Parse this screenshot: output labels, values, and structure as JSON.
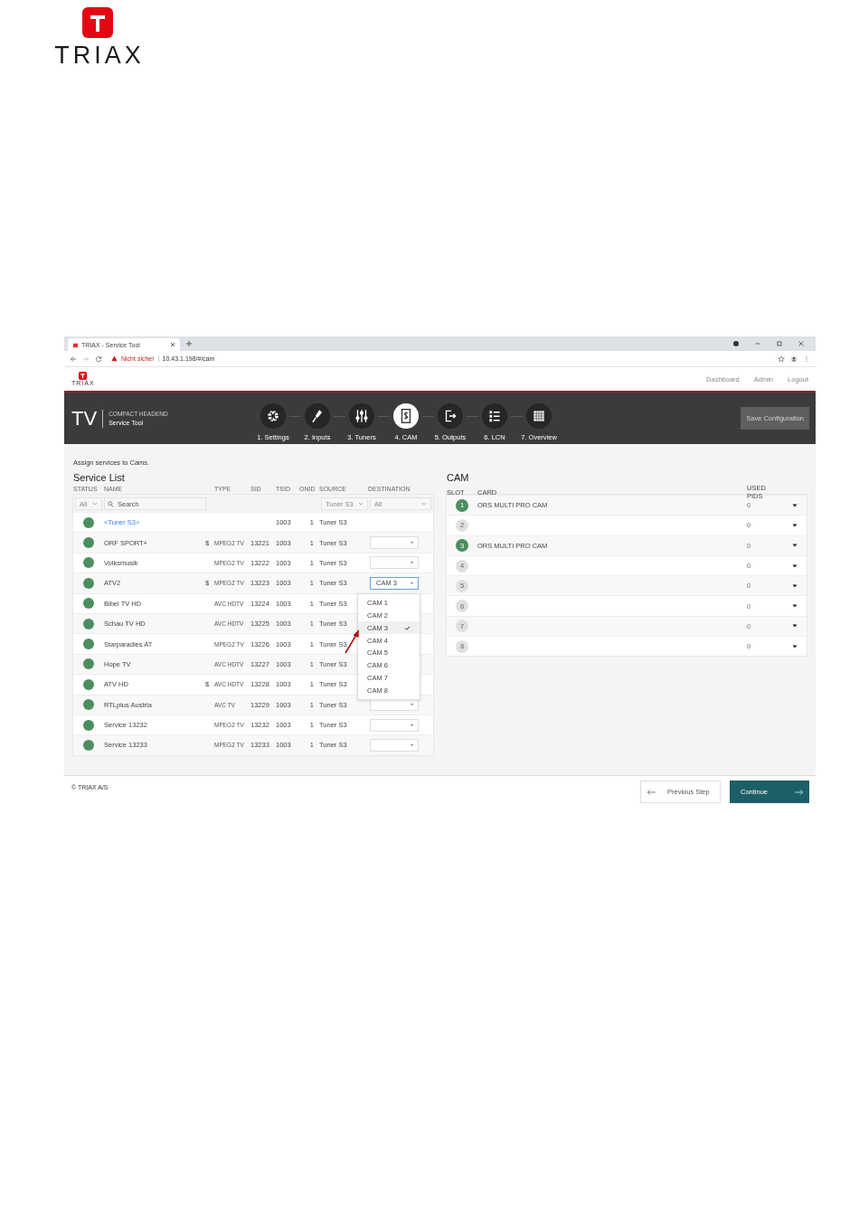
{
  "doc_logo": {
    "text": "TRIAX"
  },
  "browser": {
    "tab_title": "TRIAX - Service Tool",
    "security": "Nicht sicher",
    "url": "10.43.1.198/#/cam"
  },
  "app": {
    "logo": "TRIAX",
    "nav": [
      "Dashboard",
      "Admin",
      "Logout"
    ],
    "product": "TV",
    "subtitle": "COMPACT HEADEND",
    "title": "Service Tool",
    "steps": [
      {
        "label": "1. Settings",
        "selected": false
      },
      {
        "label": "2. Inputs",
        "selected": false
      },
      {
        "label": "3. Tuners",
        "selected": false
      },
      {
        "label": "4. CAM",
        "selected": true
      },
      {
        "label": "5. Outputs",
        "selected": false
      },
      {
        "label": "6. LCN",
        "selected": false
      },
      {
        "label": "7. Overview",
        "selected": false
      }
    ],
    "save_button": {
      "label": "Save Configuration",
      "disabled": true
    }
  },
  "instruction": "Assign services to Cams.",
  "service_list": {
    "title": "Service List",
    "columns": [
      "STATUS",
      "NAME",
      "TYPE",
      "SID",
      "TSID",
      "ONID",
      "SOURCE",
      "DESTINATION"
    ],
    "filters": {
      "status": "All",
      "search_placeholder": "Search",
      "source": "Tuner S3",
      "destination": "All"
    },
    "rows": [
      {
        "kind": "group",
        "name": "<Tuner S3>",
        "tsid": "1003",
        "onid": "1",
        "source": "Tuner S3"
      },
      {
        "kind": "service",
        "name": "ORF SPORT+",
        "scrambled": "$",
        "type": "MPEG2 TV",
        "sid": "13221",
        "tsid": "1003",
        "onid": "1",
        "source": "Tuner S3",
        "destination": {
          "focused": false
        }
      },
      {
        "kind": "service",
        "name": "Volksmusik",
        "type": "MPEG2 TV",
        "sid": "13222",
        "tsid": "1003",
        "onid": "1",
        "source": "Tuner S3",
        "destination": {
          "focused": false
        }
      },
      {
        "kind": "service",
        "name": "ATV2",
        "scrambled": "$",
        "type": "MPEG2 TV",
        "sid": "13223",
        "tsid": "1003",
        "onid": "1",
        "source": "Tuner S3",
        "destination": {
          "value": "CAM 3",
          "focused": true
        }
      },
      {
        "kind": "service",
        "name": "Bibel TV HD",
        "type": "AVC HDTV",
        "sid": "13224",
        "tsid": "1003",
        "onid": "1",
        "source": "Tuner S3"
      },
      {
        "kind": "service",
        "name": "Schau TV HD",
        "type": "AVC HDTV",
        "sid": "13225",
        "tsid": "1003",
        "onid": "1",
        "source": "Tuner S3"
      },
      {
        "kind": "service",
        "name": "Starparadies AT",
        "type": "MPEG2 TV",
        "sid": "13226",
        "tsid": "1003",
        "onid": "1",
        "source": "Tuner S3"
      },
      {
        "kind": "service",
        "name": "Hope TV",
        "type": "AVC HDTV",
        "sid": "13227",
        "tsid": "1003",
        "onid": "1",
        "source": "Tuner S3"
      },
      {
        "kind": "service",
        "name": "ATV HD",
        "scrambled": "$",
        "type": "AVC HDTV",
        "sid": "13228",
        "tsid": "1003",
        "onid": "1",
        "source": "Tuner S3"
      },
      {
        "kind": "service",
        "name": "RTLplus Austria",
        "type": "AVC TV",
        "sid": "13229",
        "tsid": "1003",
        "onid": "1",
        "source": "Tuner S3",
        "destination": {
          "focused": false
        }
      },
      {
        "kind": "service",
        "name": "Service 13232",
        "type": "MPEG2 TV",
        "sid": "13232",
        "tsid": "1003",
        "onid": "1",
        "source": "Tuner S3",
        "destination": {
          "focused": false
        }
      },
      {
        "kind": "service",
        "name": "Service 13233",
        "type": "MPEG2 TV",
        "sid": "13233",
        "tsid": "1003",
        "onid": "1",
        "source": "Tuner S3",
        "destination": {
          "focused": false
        }
      }
    ],
    "dropdown": {
      "options": [
        {
          "label": "CAM 1",
          "selected": false
        },
        {
          "label": "CAM 2",
          "selected": false
        },
        {
          "label": "CAM 3",
          "selected": true
        },
        {
          "label": "CAM 4",
          "selected": false
        },
        {
          "label": "CAM 5",
          "selected": false
        },
        {
          "label": "CAM 6",
          "selected": false
        },
        {
          "label": "CAM 7",
          "selected": false
        },
        {
          "label": "CAM 8",
          "selected": false
        }
      ]
    }
  },
  "cam": {
    "title": "CAM",
    "columns": [
      "SLOT",
      "CARD",
      "USED PIDS"
    ],
    "slots": [
      {
        "number": "1",
        "active": true,
        "card": "ORS MULTI PRO CAM",
        "used_pids": "0"
      },
      {
        "number": "2",
        "active": false,
        "used_pids": "0"
      },
      {
        "number": "3",
        "active": true,
        "card": "ORS MULTI PRO CAM",
        "used_pids": "0"
      },
      {
        "number": "4",
        "active": false,
        "used_pids": "0"
      },
      {
        "number": "5",
        "active": false,
        "used_pids": "0"
      },
      {
        "number": "6",
        "active": false,
        "used_pids": "0"
      },
      {
        "number": "7",
        "active": false,
        "used_pids": "0"
      },
      {
        "number": "8",
        "active": false,
        "used_pids": "0"
      }
    ]
  },
  "footer": {
    "copyright": "© TRIAX A/S",
    "previous": "Previous Step",
    "continue": "Continue"
  }
}
